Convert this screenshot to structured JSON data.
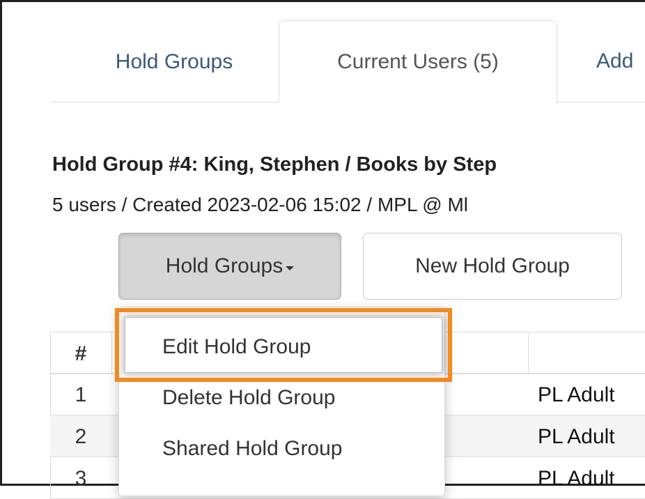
{
  "tabs": [
    {
      "label": "Hold Groups"
    },
    {
      "label": "Current Users (5)"
    },
    {
      "label": "Add"
    }
  ],
  "header": {
    "title": "Hold Group #4: King, Stephen / Books by Step",
    "meta": "5 users / Created 2023-02-06 15:02 / MPL @ Ml"
  },
  "toolbar": {
    "hold_groups_label": "Hold Groups",
    "new_hold_group_label": "New Hold Group"
  },
  "dropdown": {
    "items": [
      {
        "label": "Edit Hold Group"
      },
      {
        "label": "Delete Hold Group"
      },
      {
        "label": "Shared Hold Group"
      }
    ]
  },
  "table": {
    "headers": [
      "#"
    ],
    "rows": [
      {
        "num": "1",
        "col3": "PL Adult"
      },
      {
        "num": "2",
        "col3": "PL Adult"
      },
      {
        "num": "3",
        "col3": "PL Adult"
      }
    ]
  },
  "colors": {
    "highlight": "#f28b1f",
    "link": "#3a5a78"
  }
}
